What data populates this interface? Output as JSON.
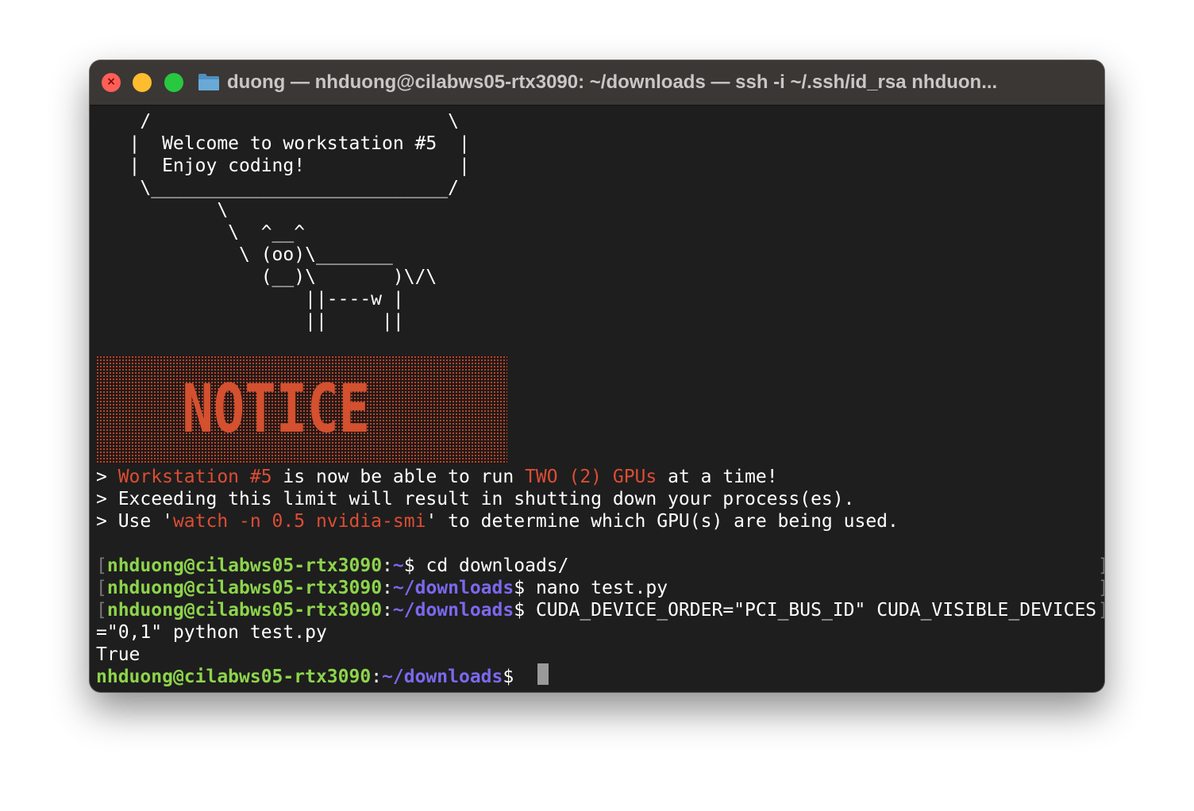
{
  "window": {
    "title": "duong — nhduong@cilabws05-rtx3090: ~/downloads — ssh -i ~/.ssh/id_rsa nhduon..."
  },
  "colors": {
    "background": "#1e1e1e",
    "accent_red": "#dc4d34",
    "prompt_user": "#8dd44b",
    "prompt_path": "#7b68ee"
  },
  "icons": {
    "close": "close-icon",
    "minimize": "minimize-icon",
    "zoom": "zoom-icon",
    "folder": "folder-icon"
  },
  "motd": {
    "cow": [
      "    /                           \\",
      "   |  Welcome to workstation #5  |",
      "   |  Enjoy coding!              |",
      "    \\___________________________/",
      "           \\",
      "            \\  ^__^",
      "             \\ (oo)\\_______",
      "               (__)\\       )\\/\\",
      "                   ||----w |",
      "                   ||     ||"
    ],
    "banner": "NOTICE",
    "notices": [
      {
        "prefix": "> ",
        "hl1": "Workstation #5",
        "mid": " is now be able to run ",
        "hl2": "TWO (2) GPUs",
        "suffix": " at a time!"
      },
      {
        "prefix": "> ",
        "text": "Exceeding this limit will result in shutting down your process(es)."
      },
      {
        "prefix": "> Use '",
        "hl1": "watch -n 0.5 nvidia-smi",
        "suffix": "' to determine which GPU(s) are being used."
      }
    ]
  },
  "session": [
    {
      "user": "nhduong@cilabws05-rtx3090",
      "sep": ":",
      "path": "~",
      "dollar": "$ ",
      "cmd": "cd downloads/"
    },
    {
      "user": "nhduong@cilabws05-rtx3090",
      "sep": ":",
      "path": "~/downloads",
      "dollar": "$ ",
      "cmd": "nano test.py"
    },
    {
      "user": "nhduong@cilabws05-rtx3090",
      "sep": ":",
      "path": "~/downloads",
      "dollar": "$ ",
      "cmd": "CUDA_DEVICE_ORDER=\"PCI_BUS_ID\" CUDA_VISIBLE_DEVICES"
    }
  ],
  "wrapped_cmd": "=\"0,1\" python test.py",
  "output": "True",
  "current_prompt": {
    "user": "nhduong@cilabws05-rtx3090",
    "sep": ":",
    "path": "~/downloads",
    "dollar": "$ "
  },
  "bracket_left": "[",
  "bracket_right": "]"
}
